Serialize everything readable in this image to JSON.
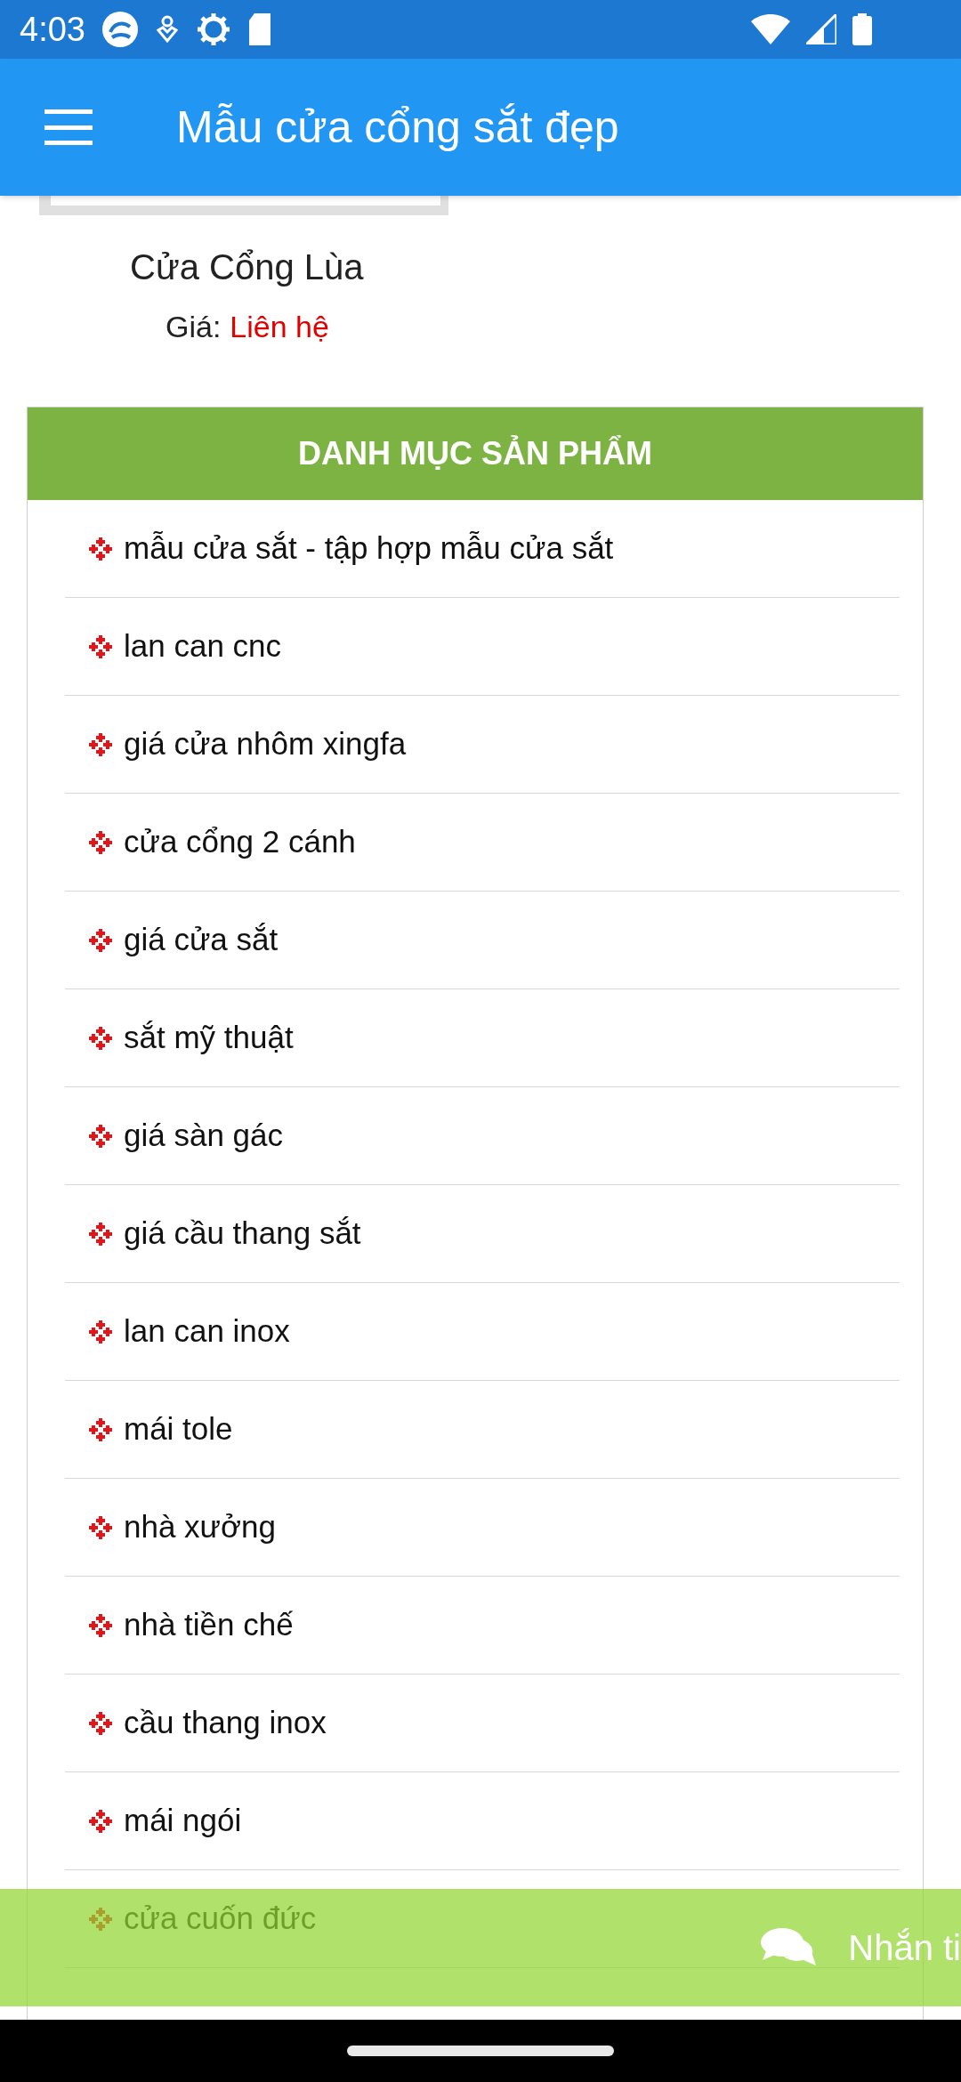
{
  "status_bar": {
    "time": "4:03"
  },
  "app_bar": {
    "title": "Mẫu cửa cổng sắt đẹp"
  },
  "product": {
    "name": "Cửa Cổng Lùa",
    "price_label": "Giá:",
    "price": "Liên hệ"
  },
  "categories": {
    "title": "DANH MỤC SẢN PHẨM",
    "items": [
      {
        "label": "mẫu cửa sắt - tập hợp mẫu cửa sắt"
      },
      {
        "label": "lan can cnc"
      },
      {
        "label": "giá cửa nhôm xingfa"
      },
      {
        "label": "cửa cổng 2 cánh"
      },
      {
        "label": "giá cửa sắt"
      },
      {
        "label": "sắt mỹ thuật"
      },
      {
        "label": "giá sàn gác"
      },
      {
        "label": "giá cầu thang sắt"
      },
      {
        "label": "lan can inox"
      },
      {
        "label": "mái tole"
      },
      {
        "label": "nhà xưởng"
      },
      {
        "label": "nhà tiền chế"
      },
      {
        "label": "cầu thang inox"
      },
      {
        "label": "mái ngói"
      },
      {
        "label": "cửa cuốn đức"
      }
    ]
  },
  "chat_bar": {
    "label": "Nhắn ti"
  }
}
